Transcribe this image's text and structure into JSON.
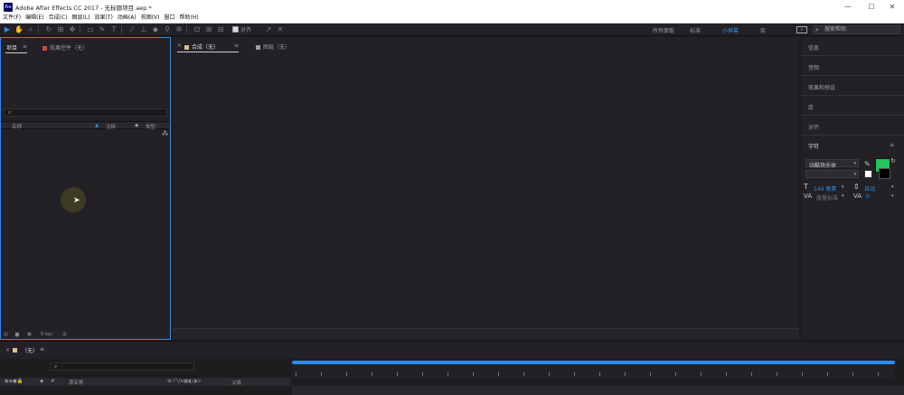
{
  "window": {
    "title": "Adobe After Effects CC 2017 - 无标题项目.aep *",
    "logo": "Ae",
    "minimize": "—",
    "maximize": "☐",
    "close": "✕"
  },
  "menu": [
    "文件(F)",
    "编辑(E)",
    "合成(C)",
    "图层(L)",
    "效果(T)",
    "动画(A)",
    "视图(V)",
    "窗口",
    "帮助(H)"
  ],
  "toolbar": {
    "snap_label": "对齐",
    "workspaces": [
      "所有面板",
      "标准",
      "小屏幕",
      "库"
    ],
    "active_workspace": "小屏幕",
    "search_placeholder": "搜索帮助"
  },
  "project_panel": {
    "tab_project": "项目",
    "tab_project_menu": "≡",
    "tab_effects": "效果控件（无）",
    "col_name": "名称",
    "col_comment": "注释",
    "col_type": "类型",
    "bpc": "8 bpc"
  },
  "comp_panel": {
    "tab_comp": "合成（无）",
    "tab_comp_menu": "≡",
    "tab_layer": "图层（无）"
  },
  "right_panel": {
    "items": [
      "信息",
      "音频",
      "效果和预设",
      "库",
      "对齐"
    ],
    "character_title": "字符",
    "font_name": "站酷快乐体",
    "font_size": "144 像素",
    "leading": "自动",
    "kerning": "度量标准",
    "tracking": "0"
  },
  "timeline": {
    "tab_label": "（无）",
    "col_source_name": "源名称",
    "col_parent": "父级"
  },
  "colors": {
    "accent": "#2d8ceb",
    "fill_color": "#22c55e",
    "project_chip": "#c54e3e",
    "comp_chip": "#d9c28a"
  }
}
